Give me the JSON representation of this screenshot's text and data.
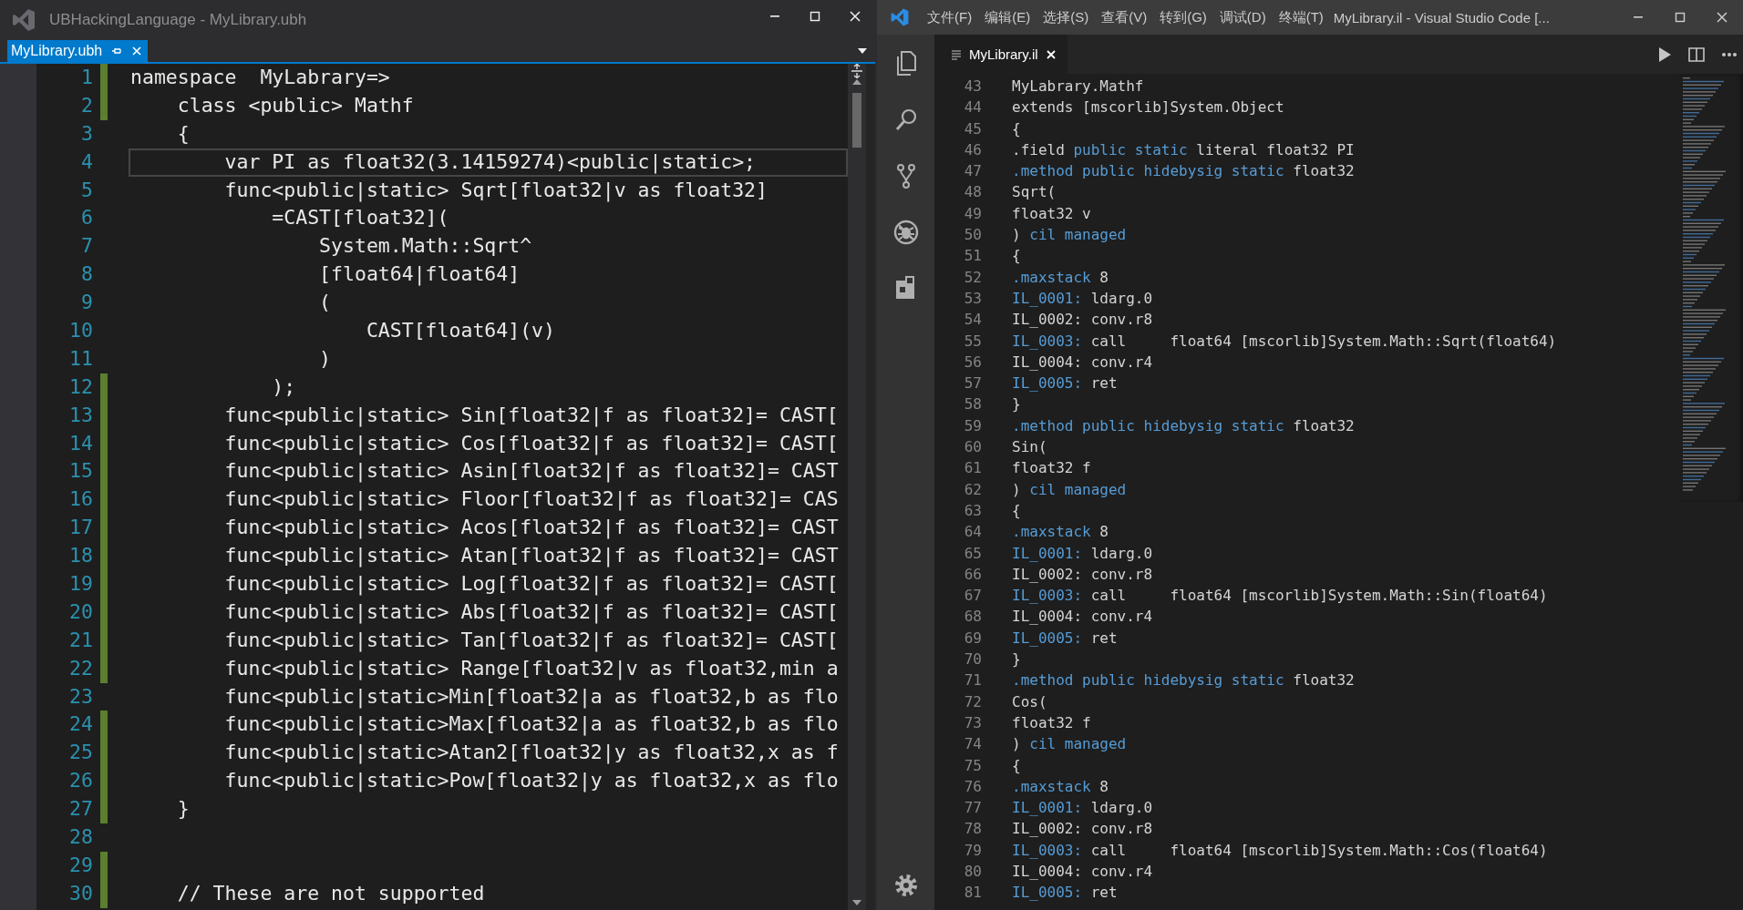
{
  "left_window": {
    "title": "UBHackingLanguage - MyLibrary.ubh",
    "tabs": [
      {
        "label": "MyLibrary.ubh",
        "selected": true
      }
    ],
    "lines": [
      {
        "number": "1",
        "text": "namespace  MyLabrary=>",
        "changed": true,
        "current": false
      },
      {
        "number": "2",
        "text": "    class <public> Mathf",
        "changed": true,
        "current": false
      },
      {
        "number": "3",
        "text": "    {",
        "changed": false,
        "current": false
      },
      {
        "number": "4",
        "text": "        var PI as float32(3.14159274)<public|static>;",
        "changed": false,
        "current": true
      },
      {
        "number": "5",
        "text": "        func<public|static> Sqrt[float32|v as float32]",
        "changed": false,
        "current": false
      },
      {
        "number": "6",
        "text": "            =CAST[float32](",
        "changed": false,
        "current": false
      },
      {
        "number": "7",
        "text": "                System.Math::Sqrt^",
        "changed": false,
        "current": false
      },
      {
        "number": "8",
        "text": "                [float64|float64]",
        "changed": false,
        "current": false
      },
      {
        "number": "9",
        "text": "                (",
        "changed": false,
        "current": false
      },
      {
        "number": "10",
        "text": "                    CAST[float64](v)",
        "changed": false,
        "current": false
      },
      {
        "number": "11",
        "text": "                )",
        "changed": false,
        "current": false
      },
      {
        "number": "12",
        "text": "            );",
        "changed": true,
        "current": false
      },
      {
        "number": "13",
        "text": "        func<public|static> Sin[float32|f as float32]= CAST[",
        "changed": true,
        "current": false
      },
      {
        "number": "14",
        "text": "        func<public|static> Cos[float32|f as float32]= CAST[",
        "changed": true,
        "current": false
      },
      {
        "number": "15",
        "text": "        func<public|static> Asin[float32|f as float32]= CAST",
        "changed": true,
        "current": false
      },
      {
        "number": "16",
        "text": "        func<public|static> Floor[float32|f as float32]= CAS",
        "changed": true,
        "current": false
      },
      {
        "number": "17",
        "text": "        func<public|static> Acos[float32|f as float32]= CAST",
        "changed": true,
        "current": false
      },
      {
        "number": "18",
        "text": "        func<public|static> Atan[float32|f as float32]= CAST",
        "changed": true,
        "current": false
      },
      {
        "number": "19",
        "text": "        func<public|static> Log[float32|f as float32]= CAST[",
        "changed": true,
        "current": false
      },
      {
        "number": "20",
        "text": "        func<public|static> Abs[float32|f as float32]= CAST[",
        "changed": true,
        "current": false
      },
      {
        "number": "21",
        "text": "        func<public|static> Tan[float32|f as float32]= CAST[",
        "changed": true,
        "current": false
      },
      {
        "number": "22",
        "text": "        func<public|static> Range[float32|v as float32,min a",
        "changed": true,
        "current": false
      },
      {
        "number": "23",
        "text": "        func<public|static>Min[float32|a as float32,b as flo",
        "changed": false,
        "current": false
      },
      {
        "number": "24",
        "text": "        func<public|static>Max[float32|a as float32,b as flo",
        "changed": true,
        "current": false
      },
      {
        "number": "25",
        "text": "        func<public|static>Atan2[float32|y as float32,x as f",
        "changed": true,
        "current": false
      },
      {
        "number": "26",
        "text": "        func<public|static>Pow[float32|y as float32,x as flo",
        "changed": true,
        "current": false
      },
      {
        "number": "27",
        "text": "    }",
        "changed": true,
        "current": false
      },
      {
        "number": "28",
        "changed": false,
        "current": false
      },
      {
        "number": "29",
        "changed": true,
        "current": false
      },
      {
        "number": "30",
        "text": "    // These are not supported",
        "changed": true,
        "current": false
      }
    ]
  },
  "right_window": {
    "menu": [
      "文件(F)",
      "编辑(E)",
      "选择(S)",
      "查看(V)",
      "转到(G)",
      "调试(D)",
      "终端(T)"
    ],
    "title": "MyLibrary.il - Visual Studio Code [...",
    "tabs": [
      {
        "label": "MyLibrary.il",
        "selected": true
      }
    ],
    "lines": [
      {
        "number": "43",
        "tokens": [
          {
            "text": "MyLabrary.Mathf",
            "kind": "plain"
          }
        ]
      },
      {
        "number": "44",
        "tokens": [
          {
            "text": "extends [mscorlib]System.Object",
            "kind": "plain"
          }
        ]
      },
      {
        "number": "45",
        "tokens": [
          {
            "text": "{",
            "kind": "plain"
          }
        ]
      },
      {
        "number": "46",
        "tokens": [
          {
            "text": ".field ",
            "kind": "plain"
          },
          {
            "text": "public static",
            "kind": "keyword"
          },
          {
            "text": " literal float32 PI",
            "kind": "plain"
          }
        ]
      },
      {
        "number": "47",
        "tokens": [
          {
            "text": ".method public hidebysig static",
            "kind": "keyword"
          },
          {
            "text": " float32",
            "kind": "plain"
          }
        ]
      },
      {
        "number": "48",
        "tokens": [
          {
            "text": "Sqrt(",
            "kind": "plain"
          }
        ]
      },
      {
        "number": "49",
        "tokens": [
          {
            "text": "float32 v",
            "kind": "plain"
          }
        ]
      },
      {
        "number": "50",
        "tokens": [
          {
            "text": ") ",
            "kind": "plain"
          },
          {
            "text": "cil managed",
            "kind": "keyword"
          }
        ]
      },
      {
        "number": "51",
        "tokens": [
          {
            "text": "{",
            "kind": "plain"
          }
        ]
      },
      {
        "number": "52",
        "tokens": [
          {
            "text": ".maxstack",
            "kind": "keyword"
          },
          {
            "text": " 8",
            "kind": "plain"
          }
        ]
      },
      {
        "number": "53",
        "tokens": [
          {
            "text": "IL_0001:",
            "kind": "keyword"
          },
          {
            "text": " ldarg.0",
            "kind": "plain"
          }
        ]
      },
      {
        "number": "54",
        "tokens": [
          {
            "text": "IL_0002: conv.r8",
            "kind": "plain"
          }
        ]
      },
      {
        "number": "55",
        "tokens": [
          {
            "text": "IL_0003:",
            "kind": "keyword"
          },
          {
            "text": " call     float64 [mscorlib]System.Math::Sqrt(float64)",
            "kind": "plain"
          }
        ]
      },
      {
        "number": "56",
        "tokens": [
          {
            "text": "IL_0004: conv.r4",
            "kind": "plain"
          }
        ]
      },
      {
        "number": "57",
        "tokens": [
          {
            "text": "IL_0005:",
            "kind": "keyword"
          },
          {
            "text": " ret",
            "kind": "plain"
          }
        ]
      },
      {
        "number": "58",
        "tokens": [
          {
            "text": "}",
            "kind": "plain"
          }
        ]
      },
      {
        "number": "59",
        "tokens": [
          {
            "text": ".method public hidebysig static",
            "kind": "keyword"
          },
          {
            "text": " float32",
            "kind": "plain"
          }
        ]
      },
      {
        "number": "60",
        "tokens": [
          {
            "text": "Sin(",
            "kind": "plain"
          }
        ]
      },
      {
        "number": "61",
        "tokens": [
          {
            "text": "float32 f",
            "kind": "plain"
          }
        ]
      },
      {
        "number": "62",
        "tokens": [
          {
            "text": ") ",
            "kind": "plain"
          },
          {
            "text": "cil managed",
            "kind": "keyword"
          }
        ]
      },
      {
        "number": "63",
        "tokens": [
          {
            "text": "{",
            "kind": "plain"
          }
        ]
      },
      {
        "number": "64",
        "tokens": [
          {
            "text": ".maxstack",
            "kind": "keyword"
          },
          {
            "text": " 8",
            "kind": "plain"
          }
        ]
      },
      {
        "number": "65",
        "tokens": [
          {
            "text": "IL_0001:",
            "kind": "keyword"
          },
          {
            "text": " ldarg.0",
            "kind": "plain"
          }
        ]
      },
      {
        "number": "66",
        "tokens": [
          {
            "text": "IL_0002: conv.r8",
            "kind": "plain"
          }
        ]
      },
      {
        "number": "67",
        "tokens": [
          {
            "text": "IL_0003:",
            "kind": "keyword"
          },
          {
            "text": " call     float64 [mscorlib]System.Math::Sin(float64)",
            "kind": "plain"
          }
        ]
      },
      {
        "number": "68",
        "tokens": [
          {
            "text": "IL_0004: conv.r4",
            "kind": "plain"
          }
        ]
      },
      {
        "number": "69",
        "tokens": [
          {
            "text": "IL_0005:",
            "kind": "keyword"
          },
          {
            "text": " ret",
            "kind": "plain"
          }
        ]
      },
      {
        "number": "70",
        "tokens": [
          {
            "text": "}",
            "kind": "plain"
          }
        ]
      },
      {
        "number": "71",
        "tokens": [
          {
            "text": ".method public hidebysig static",
            "kind": "keyword"
          },
          {
            "text": " float32",
            "kind": "plain"
          }
        ]
      },
      {
        "number": "72",
        "tokens": [
          {
            "text": "Cos(",
            "kind": "plain"
          }
        ]
      },
      {
        "number": "73",
        "tokens": [
          {
            "text": "float32 f",
            "kind": "plain"
          }
        ]
      },
      {
        "number": "74",
        "tokens": [
          {
            "text": ") ",
            "kind": "plain"
          },
          {
            "text": "cil managed",
            "kind": "keyword"
          }
        ]
      },
      {
        "number": "75",
        "tokens": [
          {
            "text": "{",
            "kind": "plain"
          }
        ]
      },
      {
        "number": "76",
        "tokens": [
          {
            "text": ".maxstack",
            "kind": "keyword"
          },
          {
            "text": " 8",
            "kind": "plain"
          }
        ]
      },
      {
        "number": "77",
        "tokens": [
          {
            "text": "IL_0001:",
            "kind": "keyword"
          },
          {
            "text": " ldarg.0",
            "kind": "plain"
          }
        ]
      },
      {
        "number": "78",
        "tokens": [
          {
            "text": "IL_0002: conv.r8",
            "kind": "plain"
          }
        ]
      },
      {
        "number": "79",
        "tokens": [
          {
            "text": "IL_0003:",
            "kind": "keyword"
          },
          {
            "text": " call     float64 [mscorlib]System.Math::Cos(float64)",
            "kind": "plain"
          }
        ]
      },
      {
        "number": "80",
        "tokens": [
          {
            "text": "IL_0004: conv.r4",
            "kind": "plain"
          }
        ]
      },
      {
        "number": "81",
        "tokens": [
          {
            "text": "IL_0005:",
            "kind": "keyword"
          },
          {
            "text": " ret",
            "kind": "plain"
          }
        ]
      }
    ]
  }
}
